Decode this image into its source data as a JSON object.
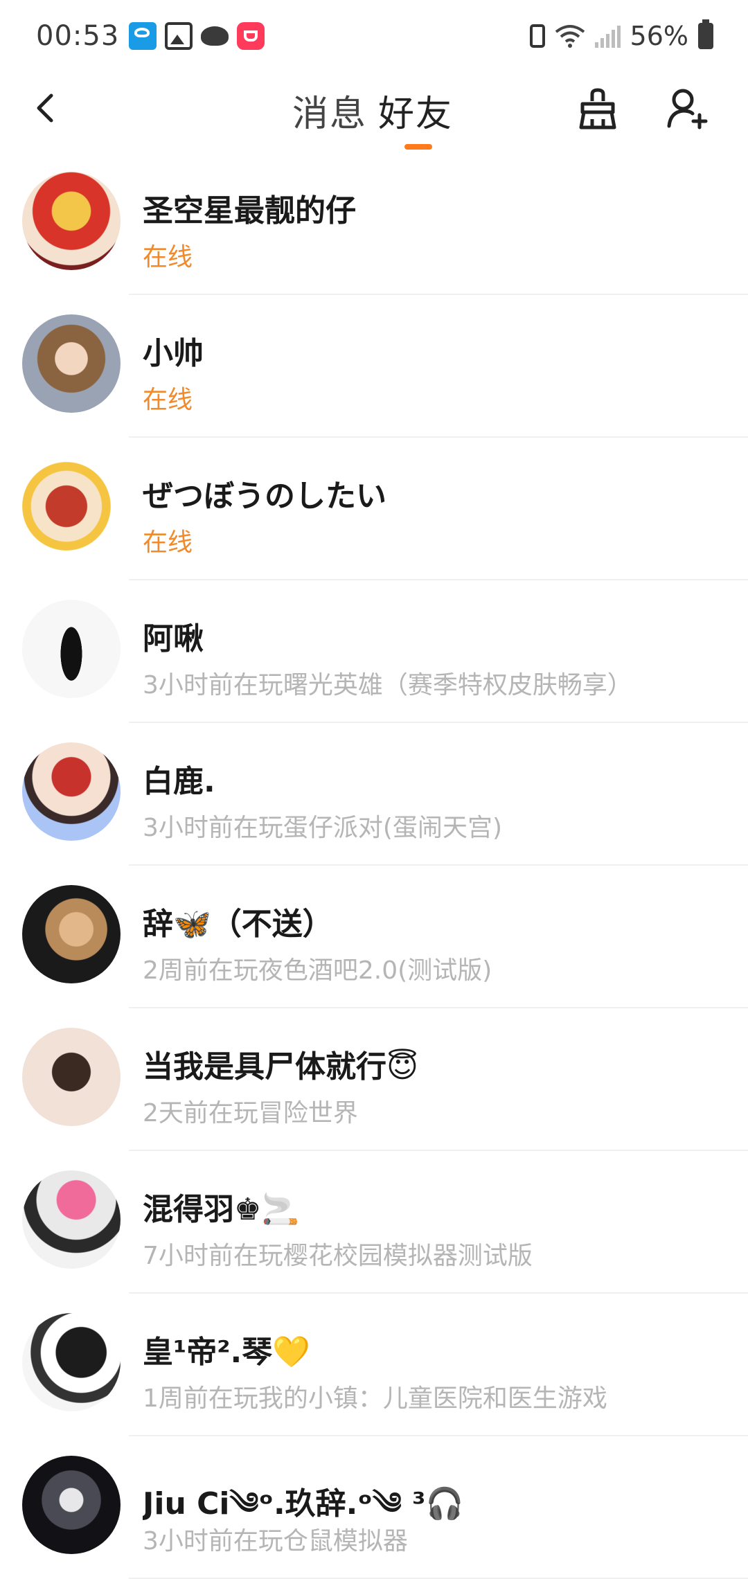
{
  "status_bar": {
    "time": "00:53",
    "battery_percent": "56%",
    "icons": [
      "mail-app-icon",
      "gallery-icon",
      "cloud-icon",
      "shopping-bag-icon",
      "battery-saver-icon",
      "wifi-icon",
      "signal-icon",
      "battery-icon"
    ]
  },
  "header": {
    "tabs": [
      {
        "label": "消息",
        "active": false
      },
      {
        "label": "好友",
        "active": true
      }
    ],
    "accent_color": "#ff7a1a",
    "icons": [
      "back-arrow-icon",
      "clean-brush-icon",
      "add-friend-icon"
    ]
  },
  "friends": [
    {
      "name": "圣空星最靓的仔",
      "status": "在线",
      "online": true
    },
    {
      "name": "小帅",
      "status": "在线",
      "online": true
    },
    {
      "name": "ぜつぼうのしたい",
      "status": "在线",
      "online": true
    },
    {
      "name": "阿啾",
      "status": "3小时前在玩曙光英雄（赛季特权皮肤畅享）",
      "online": false
    },
    {
      "name": "白鹿.",
      "status": "3小时前在玩蛋仔派对(蛋闹天宫)",
      "online": false
    },
    {
      "name": "辞🦋（不送）",
      "status": "2周前在玩夜色酒吧2.0(测试版)",
      "online": false
    },
    {
      "name": "当我是具尸体就行😇",
      "status": "2天前在玩冒险世界",
      "online": false
    },
    {
      "name": "混得羽♚🚬",
      "status": "7小时前在玩樱花校园模拟器测试版",
      "online": false
    },
    {
      "name": "皇¹帝².琴💛",
      "status": "1周前在玩我的小镇：儿童医院和医生游戏",
      "online": false
    },
    {
      "name": "Jiu Ci༄ᵒ.玖辞.ᵒ༄ ³🎧",
      "status": "3小时前在玩仓鼠模拟器",
      "online": false
    }
  ],
  "colors": {
    "online_status": "#f08a2a",
    "offline_status": "#b5b5b5",
    "divider": "#f0f0f0"
  }
}
